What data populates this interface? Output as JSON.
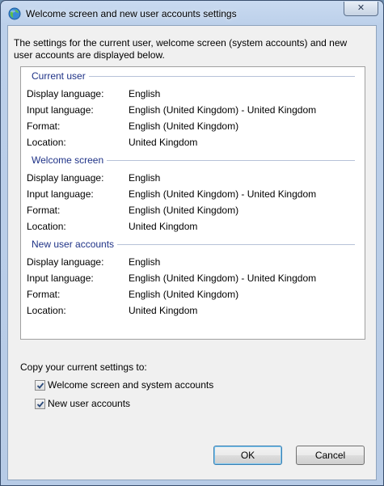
{
  "window": {
    "title": "Welcome screen and new user accounts settings",
    "close_glyph": "✕"
  },
  "description": "The settings for the current user, welcome screen (system accounts) and new user accounts are displayed below.",
  "sections": [
    {
      "title": "Current user",
      "rows": [
        {
          "label": "Display language:",
          "value": "English"
        },
        {
          "label": "Input language:",
          "value": "English (United Kingdom) - United Kingdom"
        },
        {
          "label": "Format:",
          "value": "English (United Kingdom)"
        },
        {
          "label": "Location:",
          "value": "United Kingdom"
        }
      ]
    },
    {
      "title": "Welcome screen",
      "rows": [
        {
          "label": "Display language:",
          "value": "English"
        },
        {
          "label": "Input language:",
          "value": "English (United Kingdom) - United Kingdom"
        },
        {
          "label": "Format:",
          "value": "English (United Kingdom)"
        },
        {
          "label": "Location:",
          "value": "United Kingdom"
        }
      ]
    },
    {
      "title": "New user accounts",
      "rows": [
        {
          "label": "Display language:",
          "value": "English"
        },
        {
          "label": "Input language:",
          "value": "English (United Kingdom) - United Kingdom"
        },
        {
          "label": "Format:",
          "value": "English (United Kingdom)"
        },
        {
          "label": "Location:",
          "value": "United Kingdom"
        }
      ]
    }
  ],
  "copy": {
    "label": "Copy your current settings to:",
    "options": [
      {
        "label": "Welcome screen and system accounts",
        "checked": true
      },
      {
        "label": "New user accounts",
        "checked": true
      }
    ]
  },
  "buttons": {
    "ok": "OK",
    "cancel": "Cancel"
  },
  "icons": {
    "title": "globe-icon",
    "close": "close-icon",
    "checkmark": "checkmark-icon"
  },
  "colors": {
    "section_title": "#1e3287",
    "window_frame": "#bcd0ea"
  }
}
